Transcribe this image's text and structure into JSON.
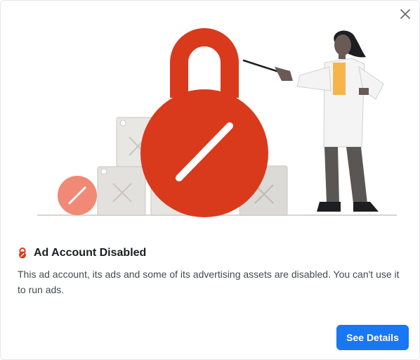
{
  "dialog": {
    "title": "Ad Account Disabled",
    "message": "This ad account, its ads and some of its advertising assets are disabled. You can't use it to run ads.",
    "primary_button_label": "See Details",
    "close_icon": "close-icon",
    "title_icon": "lock-icon"
  },
  "colors": {
    "accent": "#1877f2",
    "lock_red": "#d93a1c",
    "muted_red": "#f08a76",
    "box_gray": "#dcdad6"
  }
}
